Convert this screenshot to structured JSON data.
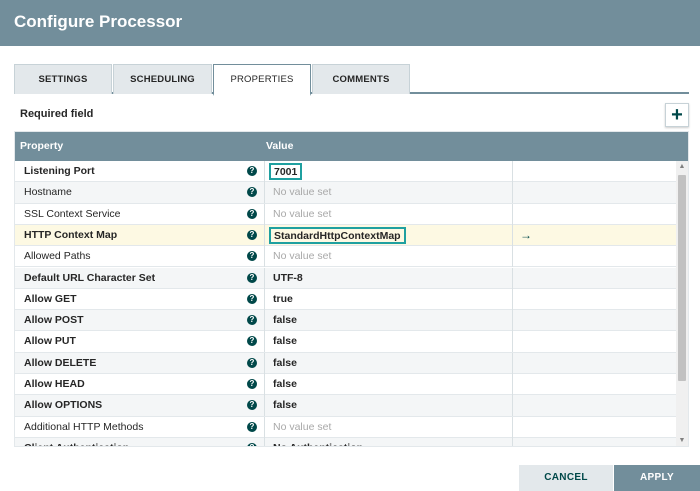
{
  "dialog": {
    "title": "Configure Processor"
  },
  "tabs": [
    {
      "label": "SETTINGS",
      "active": false
    },
    {
      "label": "SCHEDULING",
      "active": false
    },
    {
      "label": "PROPERTIES",
      "active": true
    },
    {
      "label": "COMMENTS",
      "active": false
    }
  ],
  "required_label": "Required field",
  "add_icon": "plus-icon",
  "table": {
    "headers": {
      "property": "Property",
      "value": "Value"
    },
    "rows": [
      {
        "name": "Listening Port",
        "required": true,
        "value": "7001",
        "empty": false,
        "boxed": true
      },
      {
        "name": "Hostname",
        "required": false,
        "value": "No value set",
        "empty": true
      },
      {
        "name": "SSL Context Service",
        "required": false,
        "value": "No value set",
        "empty": true
      },
      {
        "name": "HTTP Context Map",
        "required": true,
        "value": "StandardHttpContextMap",
        "empty": false,
        "boxed": true,
        "selected": true,
        "goto": "→"
      },
      {
        "name": "Allowed Paths",
        "required": false,
        "value": "No value set",
        "empty": true
      },
      {
        "name": "Default URL Character Set",
        "required": true,
        "value": "UTF-8",
        "empty": false
      },
      {
        "name": "Allow GET",
        "required": true,
        "value": "true",
        "empty": false
      },
      {
        "name": "Allow POST",
        "required": true,
        "value": "false",
        "empty": false
      },
      {
        "name": "Allow PUT",
        "required": true,
        "value": "false",
        "empty": false
      },
      {
        "name": "Allow DELETE",
        "required": true,
        "value": "false",
        "empty": false
      },
      {
        "name": "Allow HEAD",
        "required": true,
        "value": "false",
        "empty": false
      },
      {
        "name": "Allow OPTIONS",
        "required": true,
        "value": "false",
        "empty": false
      },
      {
        "name": "Additional HTTP Methods",
        "required": false,
        "value": "No value set",
        "empty": true
      },
      {
        "name": "Client Authentication",
        "required": true,
        "value": "No Authentication",
        "empty": false
      }
    ],
    "help_glyph": "?"
  },
  "buttons": {
    "cancel": "CANCEL",
    "apply": "APPLY"
  },
  "colors": {
    "header": "#728e9b",
    "accent": "#004849",
    "highlight_border": "#1fa0a0",
    "selected_row": "#fdf9e3"
  }
}
